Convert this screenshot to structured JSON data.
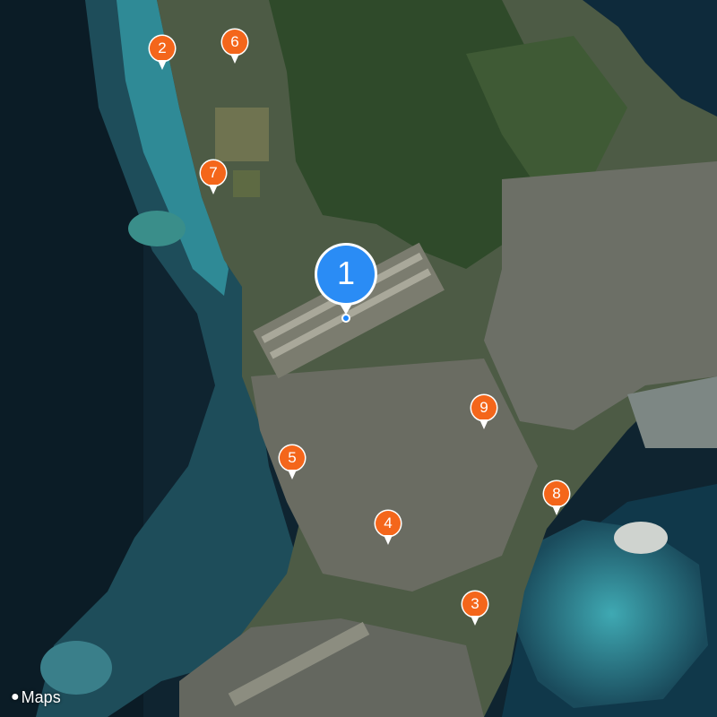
{
  "map": {
    "attribution": "Maps",
    "attribution_icon": "apple-logo-icon",
    "selected_pin": {
      "label": "1",
      "color": "#2a8cf5",
      "icon": "map-pin-icon"
    },
    "pin_color": "#f4661b",
    "pins": [
      {
        "label": "2"
      },
      {
        "label": "3"
      },
      {
        "label": "4"
      },
      {
        "label": "5"
      },
      {
        "label": "6"
      },
      {
        "label": "7"
      },
      {
        "label": "8"
      },
      {
        "label": "9"
      }
    ],
    "location_dot_color": "#1e88ff"
  }
}
